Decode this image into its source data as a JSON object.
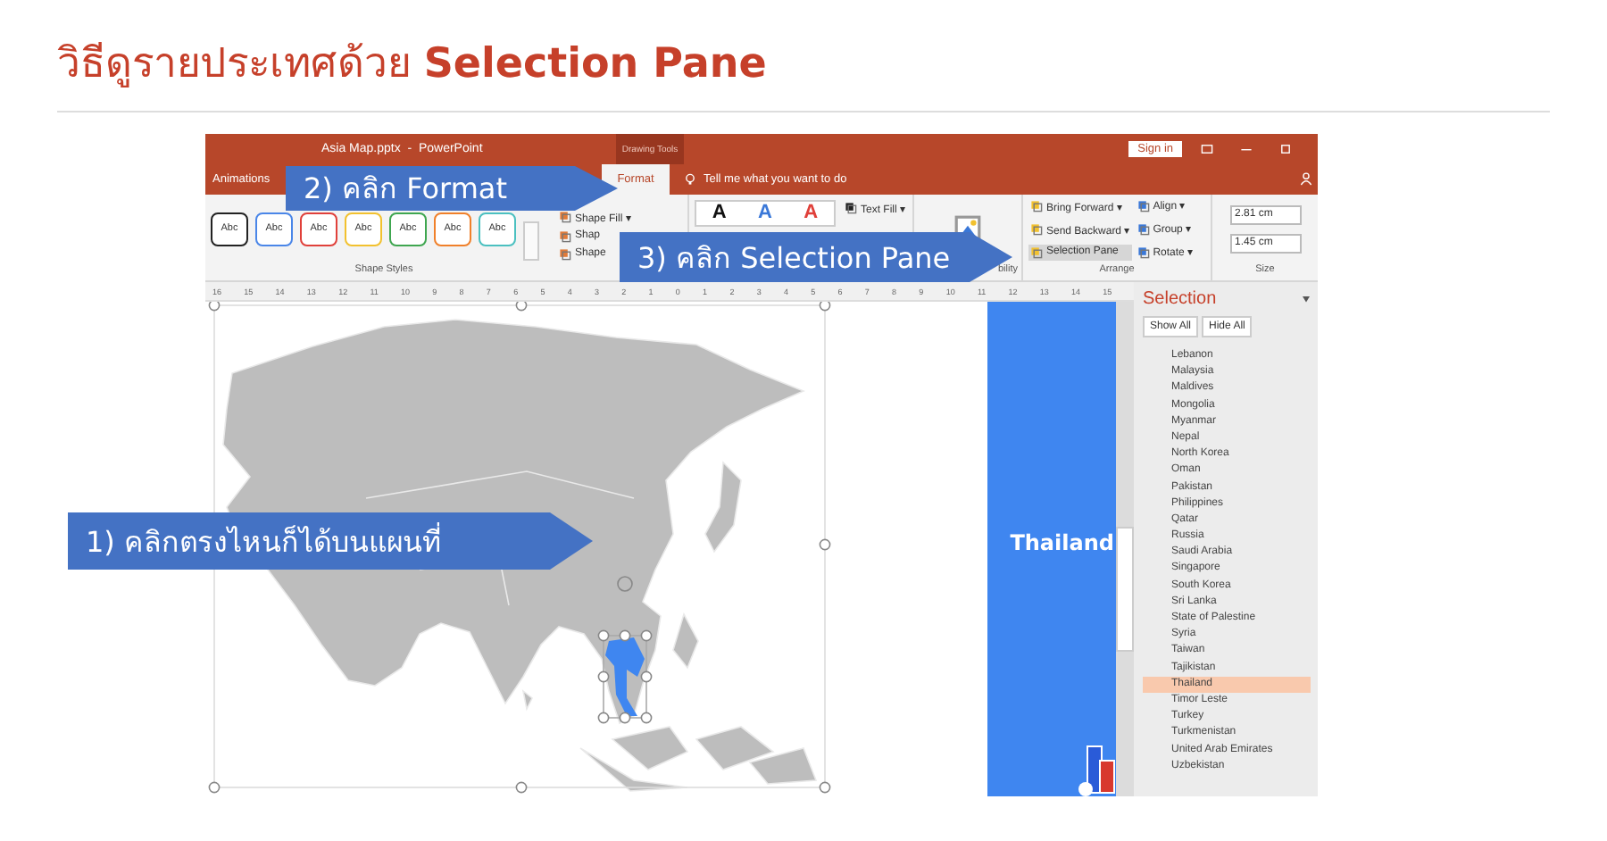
{
  "heading": "วิธีดูรายประเทศด้วย **Selection Pane**",
  "window": {
    "title": "Asia Map.pptx  -  PowerPoint",
    "context_label": "Drawing Tools",
    "sign_in": "Sign in"
  },
  "tabs": [
    {
      "label": "Animations",
      "selected": false
    },
    {
      "label": "Format",
      "selected": true
    }
  ],
  "tell_me": {
    "placeholder": "Tell me what you want to do"
  },
  "shape_styles": {
    "swatches": [
      {
        "label": "Abc",
        "color": "#222222"
      },
      {
        "label": "Abc",
        "color": "#4a86e8"
      },
      {
        "label": "Abc",
        "color": "#e0403a"
      },
      {
        "label": "Abc",
        "color": "#f2c12e"
      },
      {
        "label": "Abc",
        "color": "#3fa650"
      },
      {
        "label": "Abc",
        "color": "#f0802a"
      },
      {
        "label": "Abc",
        "color": "#4bc0c0"
      }
    ],
    "commands": [
      "Shape Fill ▾",
      "Shap",
      "Shape"
    ],
    "group_label": "Shape Styles"
  },
  "wordart": {
    "letters": [
      {
        "label": "A",
        "color": "#111111"
      },
      {
        "label": "A",
        "color": "#3a78d8"
      },
      {
        "label": "A",
        "color": "#e0403a"
      }
    ],
    "commands": [
      "Text Fill ▾"
    ]
  },
  "accessibility": {
    "group_label": "bility"
  },
  "arrange": {
    "commands": [
      {
        "label": "Bring Forward ▾",
        "selected": false
      },
      {
        "label": "Send Backward ▾",
        "selected": false
      },
      {
        "label": "Selection Pane",
        "selected": true
      },
      {
        "label": "Align ▾",
        "selected": false
      },
      {
        "label": "Group ▾",
        "selected": false
      },
      {
        "label": "Rotate ▾",
        "selected": false
      }
    ],
    "group_label": "Arrange"
  },
  "size": {
    "fields": [
      "2.81 cm",
      "1.45 cm"
    ],
    "group_label": "Size"
  },
  "ruler": [
    "16",
    "15",
    "14",
    "13",
    "12",
    "11",
    "10",
    "9",
    "8",
    "7",
    "6",
    "5",
    "4",
    "3",
    "2",
    "1",
    "0",
    "1",
    "2",
    "3",
    "4",
    "5",
    "6",
    "7",
    "8",
    "9",
    "10",
    "11",
    "12",
    "13",
    "14",
    "15"
  ],
  "slide": {
    "banner_title": "Thailand"
  },
  "selection_pane": {
    "title": "Selection",
    "buttons": [
      "Show All",
      "Hide All"
    ],
    "items": [
      {
        "label": "Lebanon",
        "selected": false
      },
      {
        "label": "Malaysia",
        "selected": false
      },
      {
        "label": "Maldives",
        "selected": false
      },
      {
        "label": "Mongolia",
        "selected": false
      },
      {
        "label": "Myanmar",
        "selected": false
      },
      {
        "label": "Nepal",
        "selected": false
      },
      {
        "label": "North Korea",
        "selected": false
      },
      {
        "label": "Oman",
        "selected": false
      },
      {
        "label": "Pakistan",
        "selected": false
      },
      {
        "label": "Philippines",
        "selected": false
      },
      {
        "label": "Qatar",
        "selected": false
      },
      {
        "label": "Russia",
        "selected": false
      },
      {
        "label": "Saudi Arabia",
        "selected": false
      },
      {
        "label": "Singapore",
        "selected": false
      },
      {
        "label": "South Korea",
        "selected": false
      },
      {
        "label": "Sri Lanka",
        "selected": false
      },
      {
        "label": "State of Palestine",
        "selected": false
      },
      {
        "label": "Syria",
        "selected": false
      },
      {
        "label": "Taiwan",
        "selected": false
      },
      {
        "label": "Tajikistan",
        "selected": false
      },
      {
        "label": "Thailand",
        "selected": true
      },
      {
        "label": "Timor Leste",
        "selected": false
      },
      {
        "label": "Turkey",
        "selected": false
      },
      {
        "label": "Turkmenistan",
        "selected": false
      },
      {
        "label": "United Arab Emirates",
        "selected": false
      },
      {
        "label": "Uzbekistan",
        "selected": false
      }
    ]
  },
  "callouts": [
    {
      "label": "2) คลิก Format"
    },
    {
      "label": "3) คลิก Selection Pane"
    },
    {
      "label": "1) คลิกตรงไหนก็ได้บนแผนที่"
    }
  ]
}
